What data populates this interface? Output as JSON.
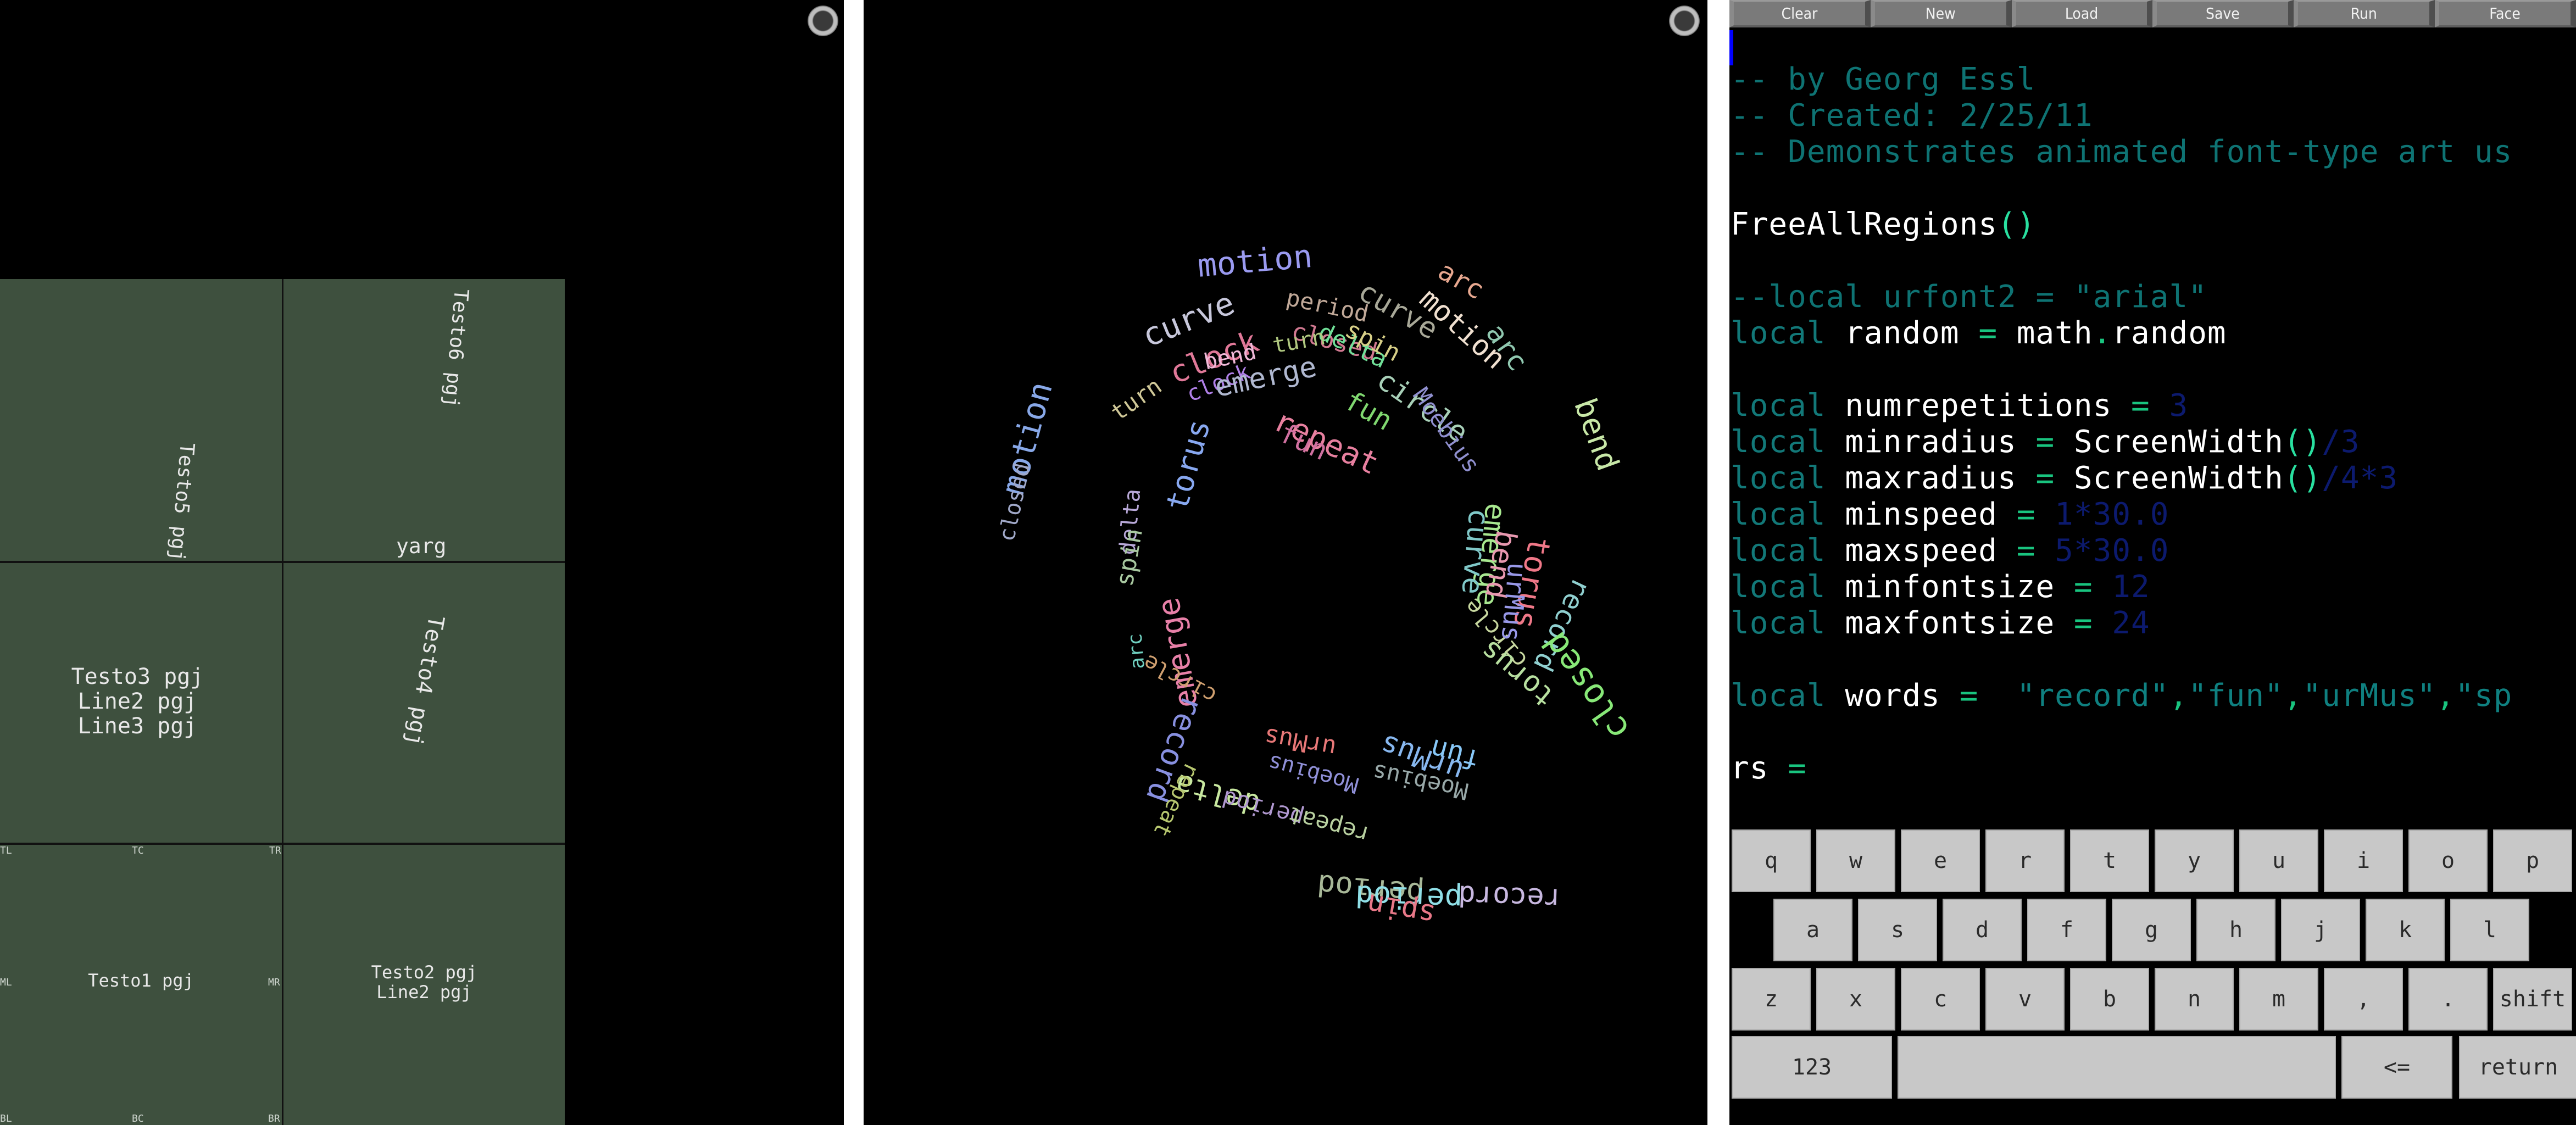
{
  "panels": {
    "left": {
      "toggle_icon": "circle-toggle-icon",
      "cells": {
        "testo6": "Testo6 pgj",
        "testo5": "Testo5 pgj",
        "yarg": "yarg",
        "testo3": "Testo3 pgj\nLine2 pgj\nLine3 pgj",
        "testo4": "Testo4 pgj",
        "testo1": "Testo1 pgj",
        "testo2": "Testo2 pgj\nLine2 pgj"
      },
      "anchors": {
        "TL": "TL",
        "TC": "TC",
        "TR": "TR",
        "ML": "ML",
        "MR": "MR",
        "BL": "BL",
        "BC": "BC",
        "BR": "BR"
      },
      "colors": {
        "cell_bg": "#3e503e",
        "text": "#e8e8e8"
      }
    },
    "middle": {
      "toggle_icon": "circle-toggle-icon",
      "words": [
        {
          "text": "motion",
          "color": "#9a9af0"
        },
        {
          "text": "curve",
          "color": "#c8c8dc"
        },
        {
          "text": "arc",
          "color": "#e8a890"
        },
        {
          "text": "motion",
          "color": "#f0e0d0"
        },
        {
          "text": "curve",
          "color": "#a8a898"
        },
        {
          "text": "arc",
          "color": "#90c8b0"
        },
        {
          "text": "period",
          "color": "#c0a898"
        },
        {
          "text": "closed",
          "color": "#d07890"
        },
        {
          "text": "delta",
          "color": "#70e098"
        },
        {
          "text": "spin",
          "color": "#d8d088"
        },
        {
          "text": "clock",
          "color": "#e07898"
        },
        {
          "text": "turn",
          "color": "#b0c880"
        },
        {
          "text": "bend",
          "color": "#f0b8d8"
        },
        {
          "text": "clock",
          "color": "#b080e8"
        },
        {
          "text": "turn",
          "color": "#d0c898"
        },
        {
          "text": "emerge",
          "color": "#b0b8d0"
        },
        {
          "text": "circle",
          "color": "#a8d0b8"
        },
        {
          "text": "fun",
          "color": "#80d870"
        },
        {
          "text": "Moebius",
          "color": "#9090d0"
        },
        {
          "text": "repeat",
          "color": "#e880a0"
        },
        {
          "text": "fun",
          "color": "#d070a0"
        },
        {
          "text": "bend",
          "color": "#c8e8a8"
        },
        {
          "text": "motion",
          "color": "#88a8e8"
        },
        {
          "text": "closed",
          "color": "#a0a8c8"
        },
        {
          "text": "torus",
          "color": "#88a8f0"
        },
        {
          "text": "delta",
          "color": "#b8a8d8"
        },
        {
          "text": "spin",
          "color": "#a8c8a0"
        },
        {
          "text": "arc",
          "color": "#70d0c0"
        },
        {
          "text": "emerge",
          "color": "#e880a8"
        },
        {
          "text": "circle",
          "color": "#d0a070"
        },
        {
          "text": "urMus",
          "color": "#e87878"
        },
        {
          "text": "Moebius",
          "color": "#9090d8"
        },
        {
          "text": "delta",
          "color": "#c8e8a0"
        },
        {
          "text": "period",
          "color": "#b098d0"
        },
        {
          "text": "repeat",
          "color": "#b8d0a0"
        },
        {
          "text": "urMus",
          "color": "#88b8f0"
        },
        {
          "text": "fun",
          "color": "#88c8f8"
        },
        {
          "text": "torus",
          "color": "#b8e0a0"
        },
        {
          "text": "circle",
          "color": "#c8d8a0"
        },
        {
          "text": "Moebius",
          "color": "#98a8a8"
        },
        {
          "text": "record",
          "color": "#8890e0"
        },
        {
          "text": "repeat",
          "color": "#b8c870"
        },
        {
          "text": "emerge",
          "color": "#a8e890"
        },
        {
          "text": "torus",
          "color": "#f07888"
        },
        {
          "text": "bend",
          "color": "#e898b0"
        },
        {
          "text": "curve",
          "color": "#80c8c8"
        },
        {
          "text": "urMus",
          "color": "#9898e8"
        },
        {
          "text": "record",
          "color": "#90d0d0"
        },
        {
          "text": "closed",
          "color": "#88e878"
        },
        {
          "text": "period",
          "color": "#a8b898"
        },
        {
          "text": "period",
          "color": "#90e0e8"
        },
        {
          "text": "spin",
          "color": "#e87888"
        },
        {
          "text": "record",
          "color": "#c8b8e0"
        }
      ]
    },
    "right": {
      "toolbar": [
        {
          "label": "Clear"
        },
        {
          "label": "New"
        },
        {
          "label": "Load"
        },
        {
          "label": "Save"
        },
        {
          "label": "Run"
        },
        {
          "label": "Face"
        }
      ],
      "code_lines": [
        [
          {
            "t": "-- by Georg Essl",
            "c": "com"
          }
        ],
        [
          {
            "t": "-- Created: 2/25/11",
            "c": "com"
          }
        ],
        [
          {
            "t": "-- Demonstrates animated font-type art us",
            "c": "com"
          }
        ],
        [],
        [
          {
            "t": "FreeAllRegions",
            "c": "id"
          },
          {
            "t": "()",
            "c": "paren"
          }
        ],
        [],
        [
          {
            "t": "--local urfont2 = \"arial\"",
            "c": "com"
          }
        ],
        [
          {
            "t": "local ",
            "c": "kw"
          },
          {
            "t": "random ",
            "c": "id"
          },
          {
            "t": "=",
            "c": "op"
          },
          {
            "t": " math",
            "c": "id"
          },
          {
            "t": ".",
            "c": "op"
          },
          {
            "t": "random",
            "c": "id"
          }
        ],
        [],
        [
          {
            "t": "local ",
            "c": "kw"
          },
          {
            "t": "numrepetitions ",
            "c": "id"
          },
          {
            "t": "=",
            "c": "op"
          },
          {
            "t": " 3",
            "c": "num"
          }
        ],
        [
          {
            "t": "local ",
            "c": "kw"
          },
          {
            "t": "minradius ",
            "c": "id"
          },
          {
            "t": "=",
            "c": "op"
          },
          {
            "t": " ScreenWidth",
            "c": "id"
          },
          {
            "t": "()",
            "c": "paren"
          },
          {
            "t": "/3",
            "c": "num"
          }
        ],
        [
          {
            "t": "local ",
            "c": "kw"
          },
          {
            "t": "maxradius ",
            "c": "id"
          },
          {
            "t": "=",
            "c": "op"
          },
          {
            "t": " ScreenWidth",
            "c": "id"
          },
          {
            "t": "()",
            "c": "paren"
          },
          {
            "t": "/4*3",
            "c": "num"
          }
        ],
        [
          {
            "t": "local ",
            "c": "kw"
          },
          {
            "t": "minspeed ",
            "c": "id"
          },
          {
            "t": "=",
            "c": "op"
          },
          {
            "t": " 1*30.0",
            "c": "num"
          }
        ],
        [
          {
            "t": "local ",
            "c": "kw"
          },
          {
            "t": "maxspeed ",
            "c": "id"
          },
          {
            "t": "=",
            "c": "op"
          },
          {
            "t": " 5*30.0",
            "c": "num"
          }
        ],
        [
          {
            "t": "local ",
            "c": "kw"
          },
          {
            "t": "minfontsize ",
            "c": "id"
          },
          {
            "t": "=",
            "c": "op"
          },
          {
            "t": " 12",
            "c": "num"
          }
        ],
        [
          {
            "t": "local ",
            "c": "kw"
          },
          {
            "t": "maxfontsize ",
            "c": "id"
          },
          {
            "t": "=",
            "c": "op"
          },
          {
            "t": " 24",
            "c": "num"
          }
        ],
        [],
        [
          {
            "t": "local ",
            "c": "kw"
          },
          {
            "t": "words ",
            "c": "id"
          },
          {
            "t": "=",
            "c": "op"
          },
          {
            "t": "  \"record\"",
            "c": "str"
          },
          {
            "t": ",",
            "c": "op"
          },
          {
            "t": "\"fun\"",
            "c": "str"
          },
          {
            "t": ",",
            "c": "op"
          },
          {
            "t": "\"urMus\"",
            "c": "str"
          },
          {
            "t": ",",
            "c": "op"
          },
          {
            "t": "\"sp",
            "c": "str"
          }
        ],
        [],
        [
          {
            "t": "rs ",
            "c": "id"
          },
          {
            "t": "=",
            "c": "op"
          }
        ]
      ],
      "keyboard": {
        "row1": [
          "q",
          "w",
          "e",
          "r",
          "t",
          "y",
          "u",
          "i",
          "o",
          "p"
        ],
        "row2": [
          "a",
          "s",
          "d",
          "f",
          "g",
          "h",
          "j",
          "k",
          "l"
        ],
        "row3": [
          "z",
          "x",
          "c",
          "v",
          "b",
          "n",
          "m",
          ",",
          ".",
          "shift"
        ],
        "row4": [
          "123",
          "",
          "<=",
          "return"
        ]
      },
      "colors": {
        "caret": "#0000ff",
        "key_bg": "#c8c8c8",
        "toolbar_bg": "#7a7a7a"
      }
    }
  }
}
